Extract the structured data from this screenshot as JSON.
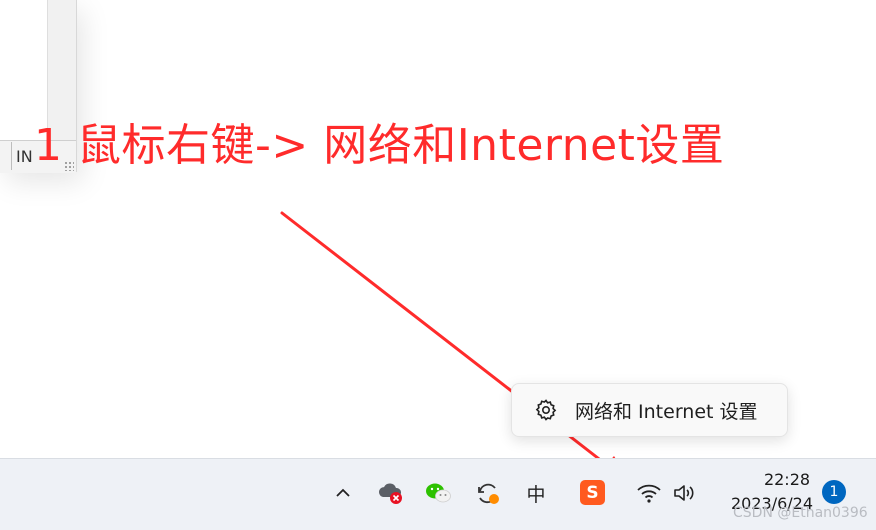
{
  "window_fragment": {
    "status_text": "IN"
  },
  "annotation": {
    "text": "1 鼠标右键-> 网络和Internet设置",
    "color": "#ff2b2b"
  },
  "tooltip": {
    "icon": "gear-icon",
    "label": "网络和 Internet 设置"
  },
  "taskbar": {
    "tray_icons": [
      "chevron-up-icon",
      "cloud-error-icon",
      "wechat-icon",
      "sync-icon",
      "ime-chinese-icon",
      "sogou-input-icon",
      "wifi-icon",
      "volume-icon"
    ],
    "ime_label": "中",
    "sogou_label": "S",
    "clock": {
      "time": "22:28",
      "date": "2023/6/24"
    },
    "notification_count": "1"
  },
  "watermark": "CSDN @Ethan0396",
  "colors": {
    "accent": "#0067c0",
    "arrow": "#ff2b2b",
    "taskbar_bg": "#eef1f6"
  }
}
